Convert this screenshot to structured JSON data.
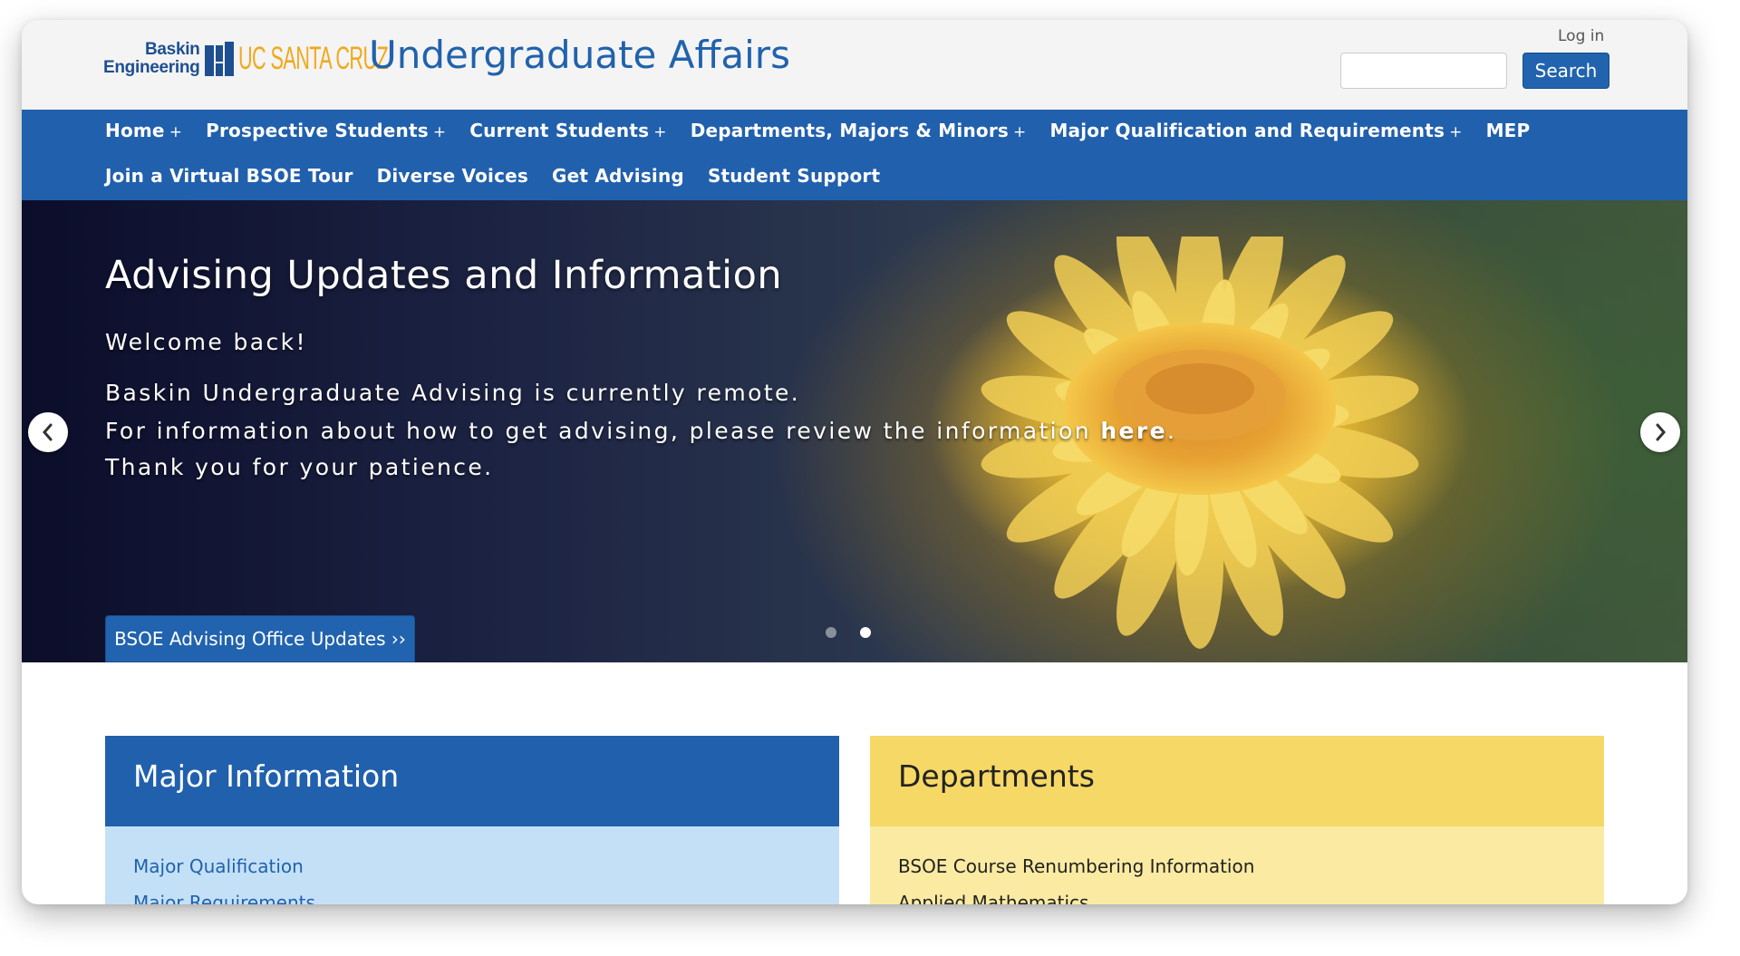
{
  "header": {
    "logo": {
      "baskin_line1": "Baskin",
      "baskin_line2": "Engineering",
      "ucsc_text": "UC SANTA CRUZ"
    },
    "site_title": "Undergraduate Affairs",
    "login_label": "Log in",
    "search": {
      "value": "",
      "button_label": "Search"
    }
  },
  "nav": {
    "row1": [
      {
        "label": "Home",
        "has_submenu": true,
        "plus": "+"
      },
      {
        "label": "Prospective Students",
        "has_submenu": true,
        "plus": "+"
      },
      {
        "label": "Current Students",
        "has_submenu": true,
        "plus": "+"
      },
      {
        "label": "Departments, Majors & Minors",
        "has_submenu": true,
        "plus": "+"
      },
      {
        "label": "Major Qualification and Requirements",
        "has_submenu": true,
        "plus": "+"
      },
      {
        "label": "MEP",
        "has_submenu": false
      }
    ],
    "row2": [
      {
        "label": "Join a Virtual BSOE Tour"
      },
      {
        "label": "Diverse Voices"
      },
      {
        "label": "Get Advising"
      },
      {
        "label": "Student Support"
      }
    ]
  },
  "hero": {
    "title": "Advising Updates and Information",
    "welcome": "Welcome back!",
    "line1": "Baskin Undergraduate Advising is currently remote.",
    "line2_prefix": "For information about how to get advising, please review the information ",
    "line2_link": "here",
    "line2_suffix": ".",
    "line3": "Thank you for your patience.",
    "button_label": "BSOE Advising Office Updates ››",
    "slide_count": 2,
    "active_slide": 2,
    "prev_icon": "chevron-left-icon",
    "next_icon": "chevron-right-icon"
  },
  "cards": {
    "major": {
      "title": "Major Information",
      "links": [
        "Major Qualification",
        "Major Requirements"
      ]
    },
    "departments": {
      "title": "Departments",
      "links": [
        "BSOE Course Renumbering Information",
        "Applied Mathematics"
      ]
    }
  },
  "colors": {
    "brand_blue": "#2160ad",
    "ucsc_gold": "#f1a91d",
    "major_panel": "#c4e0f7",
    "dept_header": "#f5d866",
    "dept_panel": "#fbeba2"
  }
}
